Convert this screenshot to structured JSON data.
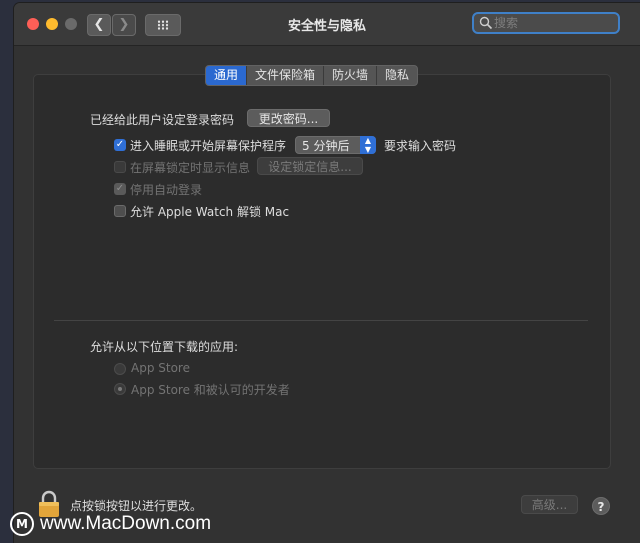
{
  "window": {
    "title": "安全性与隐私",
    "search_placeholder": "搜索"
  },
  "tabs": [
    {
      "label": "通用",
      "active": true
    },
    {
      "label": "文件保险箱",
      "active": false
    },
    {
      "label": "防火墙",
      "active": false
    },
    {
      "label": "隐私",
      "active": false
    }
  ],
  "general": {
    "password_label": "已经给此用户设定登录密码",
    "change_password_button": "更改密码...",
    "require_password": {
      "checked": true,
      "label_before": "进入睡眠或开始屏幕保护程序",
      "delay_value": "5 分钟后",
      "label_after": "要求输入密码"
    },
    "show_message": {
      "checked": false,
      "enabled": false,
      "label": "在屏幕锁定时显示信息",
      "button": "设定锁定信息..."
    },
    "disable_autologin": {
      "checked": true,
      "enabled": false,
      "label": "停用自动登录"
    },
    "apple_watch": {
      "checked": false,
      "enabled": true,
      "label": "允许 Apple Watch 解锁 Mac"
    }
  },
  "downloads": {
    "label": "允许从以下位置下载的应用:",
    "options": [
      {
        "label": "App Store",
        "selected": false
      },
      {
        "label": "App Store 和被认可的开发者",
        "selected": true
      }
    ]
  },
  "footer": {
    "lock_text": "点按锁按钮以进行更改。",
    "advanced_button": "高级...",
    "help_button": "?"
  },
  "watermark": {
    "text": "www.MacDown.com"
  }
}
